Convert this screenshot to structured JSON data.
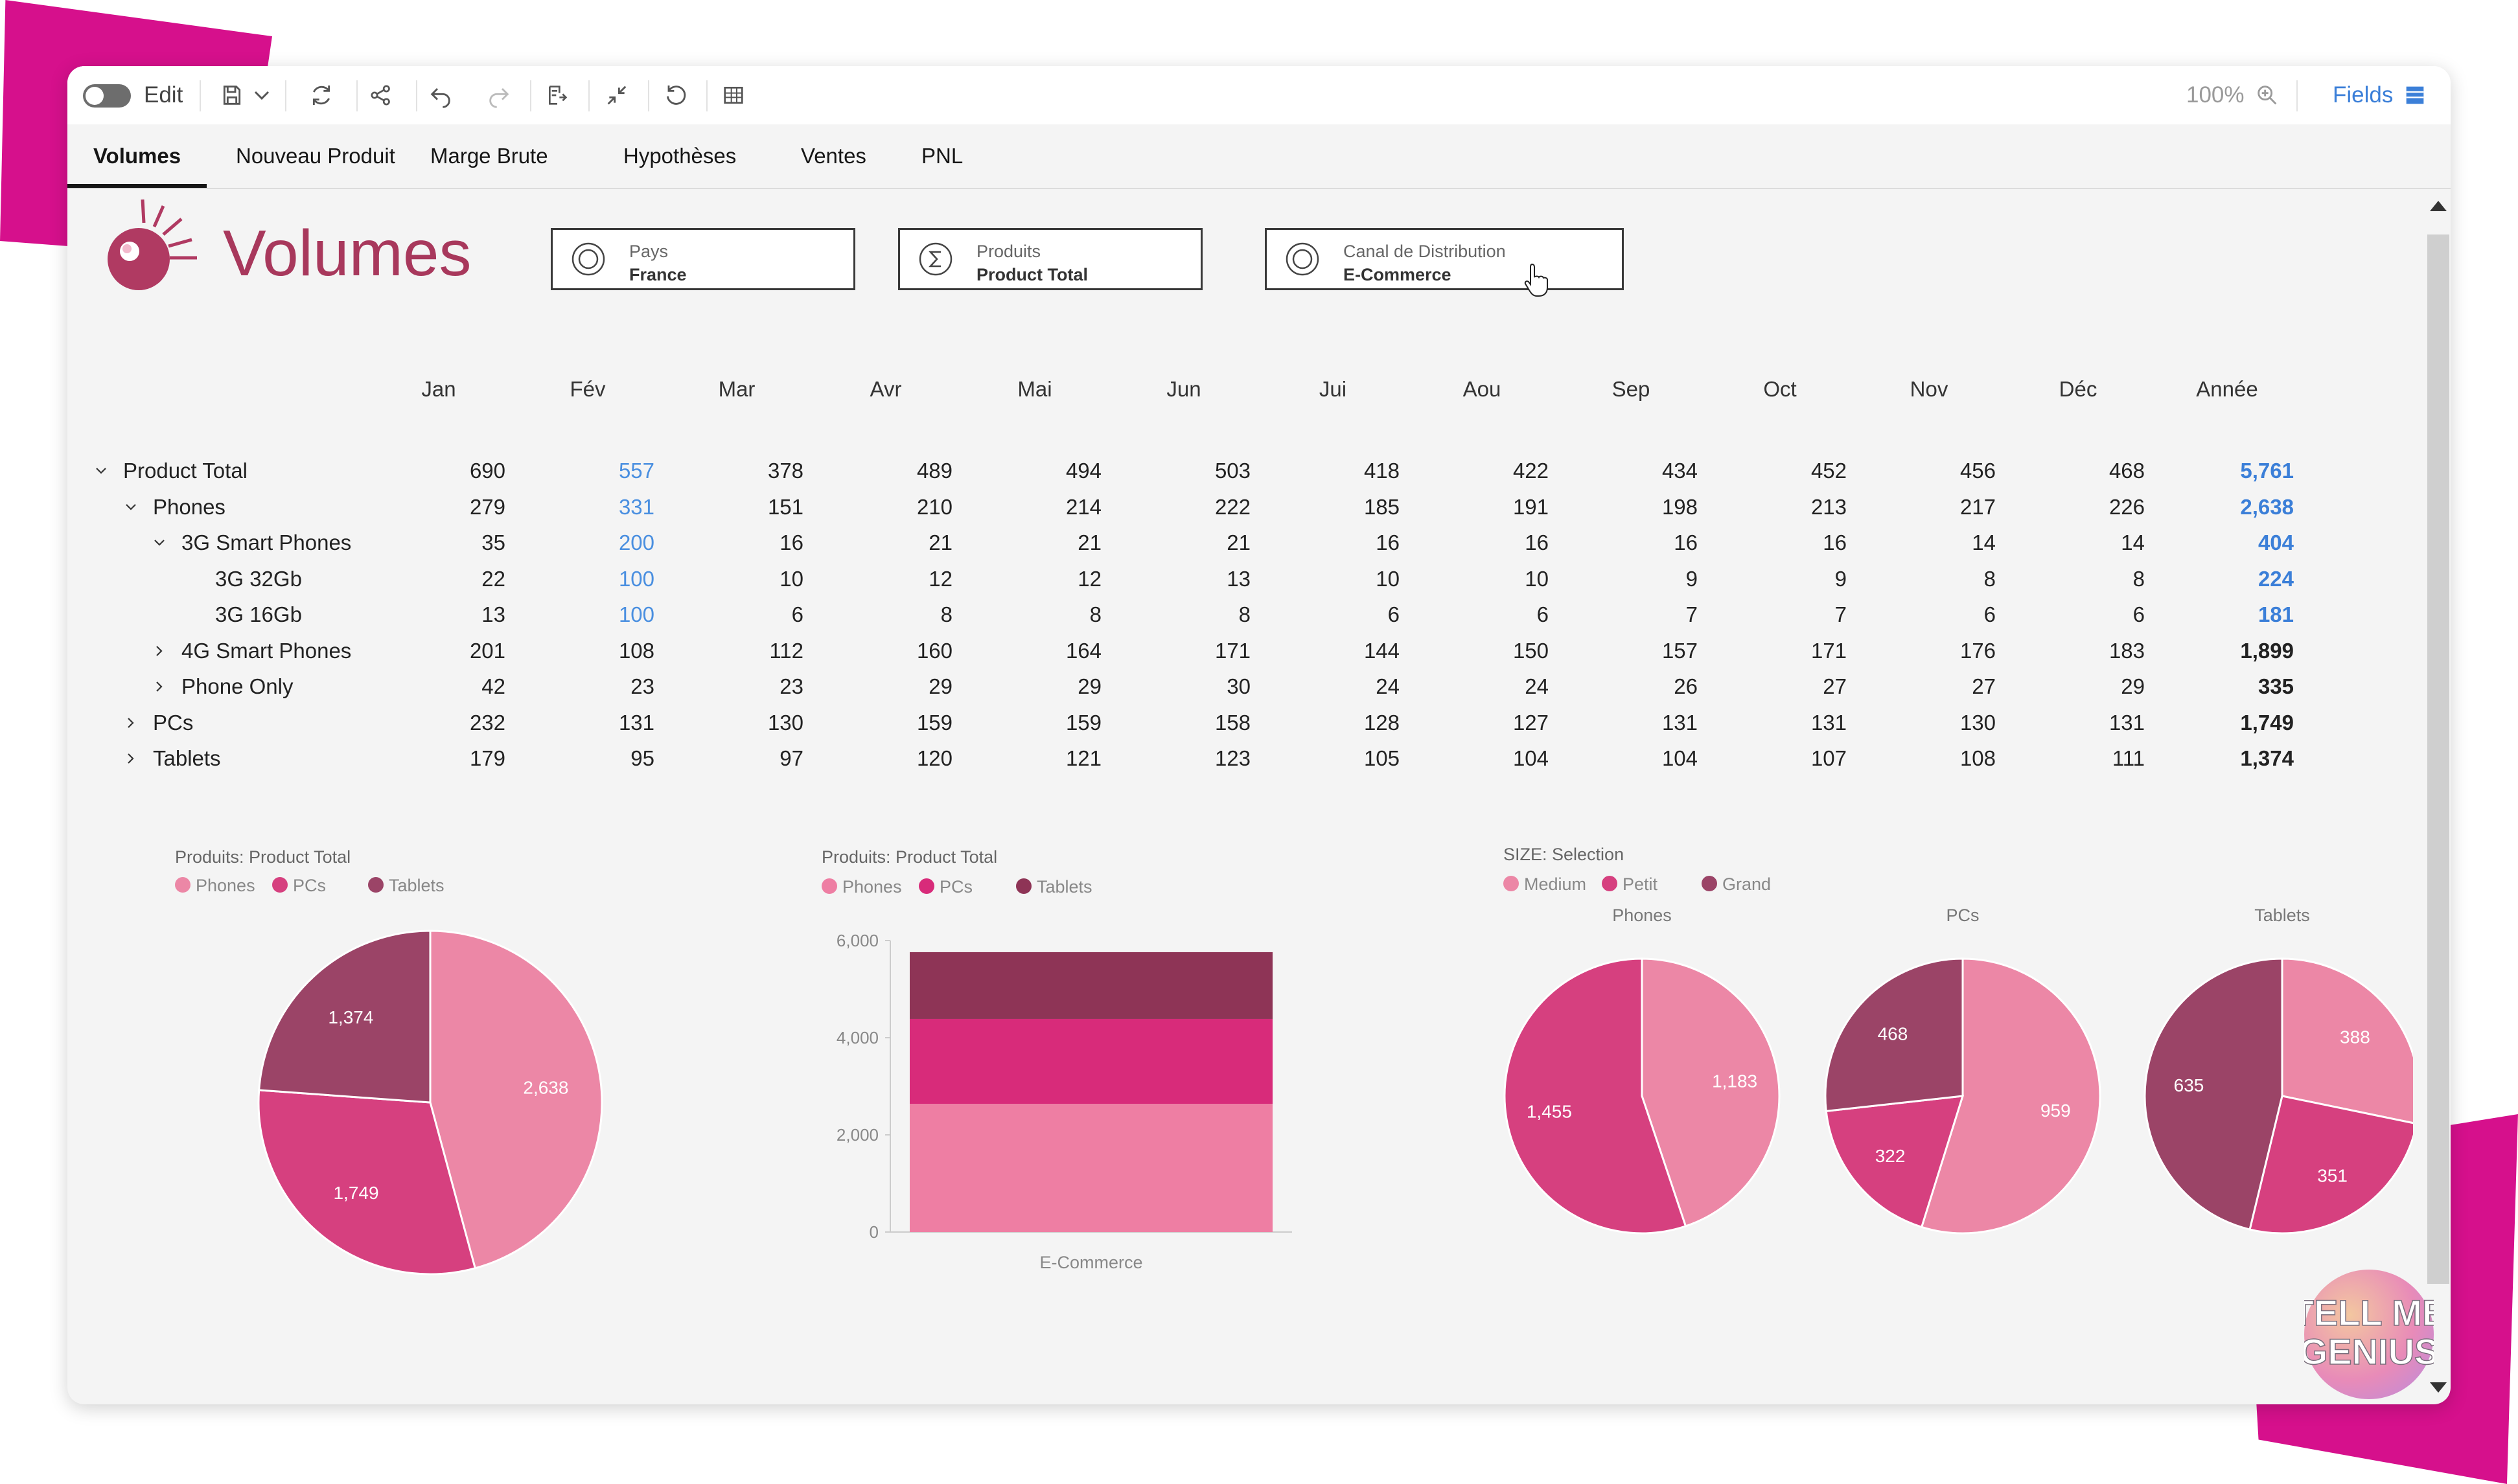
{
  "toolbar": {
    "edit_label": "Edit",
    "zoom": "100%",
    "fields_label": "Fields"
  },
  "tabs": [
    {
      "label": "Volumes"
    },
    {
      "label": "Nouveau Produit"
    },
    {
      "label": "Marge Brute"
    },
    {
      "label": "Hypothèses"
    },
    {
      "label": "Ventes"
    },
    {
      "label": "PNL"
    }
  ],
  "page": {
    "title": "Volumes"
  },
  "filters": [
    {
      "label": "Pays",
      "value": "France",
      "icon": "circle-icon"
    },
    {
      "label": "Produits",
      "value": "Product Total",
      "icon": "sigma-icon"
    },
    {
      "label": "Canal de Distribution",
      "value": "E-Commerce",
      "icon": "circle-icon"
    }
  ],
  "table": {
    "columns": [
      "Jan",
      "Fév",
      "Mar",
      "Avr",
      "Mai",
      "Jun",
      "Jui",
      "Aou",
      "Sep",
      "Oct",
      "Nov",
      "Déc",
      "Année"
    ],
    "rows": [
      {
        "label": "Product Total",
        "values": [
          "690",
          "557",
          "378",
          "489",
          "494",
          "503",
          "418",
          "422",
          "434",
          "452",
          "456",
          "468",
          "5,761"
        ]
      },
      {
        "label": "Phones",
        "values": [
          "279",
          "331",
          "151",
          "210",
          "214",
          "222",
          "185",
          "191",
          "198",
          "213",
          "217",
          "226",
          "2,638"
        ]
      },
      {
        "label": "3G Smart Phones",
        "values": [
          "35",
          "200",
          "16",
          "21",
          "21",
          "21",
          "16",
          "16",
          "16",
          "16",
          "14",
          "14",
          "404"
        ]
      },
      {
        "label": "3G 32Gb",
        "values": [
          "22",
          "100",
          "10",
          "12",
          "12",
          "13",
          "10",
          "10",
          "9",
          "9",
          "8",
          "8",
          "224"
        ]
      },
      {
        "label": "3G 16Gb",
        "values": [
          "13",
          "100",
          "6",
          "8",
          "8",
          "8",
          "6",
          "6",
          "7",
          "7",
          "6",
          "6",
          "181"
        ]
      },
      {
        "label": "4G Smart Phones",
        "values": [
          "201",
          "108",
          "112",
          "160",
          "164",
          "171",
          "144",
          "150",
          "157",
          "171",
          "176",
          "183",
          "1,899"
        ]
      },
      {
        "label": "Phone Only",
        "values": [
          "42",
          "23",
          "23",
          "29",
          "29",
          "30",
          "24",
          "24",
          "26",
          "27",
          "27",
          "29",
          "335"
        ]
      },
      {
        "label": "PCs",
        "values": [
          "232",
          "131",
          "130",
          "159",
          "159",
          "158",
          "128",
          "127",
          "131",
          "131",
          "130",
          "131",
          "1,749"
        ]
      },
      {
        "label": "Tablets",
        "values": [
          "179",
          "95",
          "97",
          "120",
          "121",
          "123",
          "105",
          "104",
          "104",
          "107",
          "108",
          "111",
          "1,374"
        ]
      }
    ]
  },
  "colors": {
    "light_pink": "#ec87a6",
    "magenta": "#d6407f",
    "plum": "#9b4467",
    "bar_light": "#ee7ea3",
    "bar_mid": "#d82b7a",
    "bar_dark": "#8e3456",
    "title": "#a8385c",
    "link_blue": "#4a8fe0"
  },
  "chart_data": [
    {
      "type": "pie",
      "subtitle": "Produits: Product Total",
      "legend": [
        "Phones",
        "PCs",
        "Tablets"
      ],
      "values": [
        2638,
        1749,
        1374
      ],
      "labels": [
        "2,638",
        "1,749",
        "1,374"
      ],
      "colors": [
        "#ec87a6",
        "#d6407f",
        "#9b4467"
      ]
    },
    {
      "type": "bar",
      "stacked": true,
      "subtitle": "Produits: Product Total",
      "legend": [
        "Phones",
        "PCs",
        "Tablets"
      ],
      "categories": [
        "E-Commerce"
      ],
      "series": [
        {
          "name": "Phones",
          "values": [
            2638
          ],
          "color": "#ee7ea3"
        },
        {
          "name": "PCs",
          "values": [
            1749
          ],
          "color": "#d82b7a"
        },
        {
          "name": "Tablets",
          "values": [
            1374
          ],
          "color": "#8e3456"
        }
      ],
      "ylim": [
        0,
        6000
      ],
      "yticks": [
        "0",
        "2,000",
        "4,000",
        "6,000"
      ]
    },
    {
      "type": "pie",
      "subtitle": "SIZE: Selection",
      "legend": [
        "Medium",
        "Petit",
        "Grand"
      ],
      "legend_colors": [
        "#ec87a6",
        "#d6407f",
        "#9b4467"
      ],
      "pies": [
        {
          "title": "Phones",
          "values": [
            1183,
            1455
          ],
          "labels": [
            "1,183",
            "1,455"
          ],
          "colors": [
            "#ec87a6",
            "#d6407f"
          ]
        },
        {
          "title": "PCs",
          "values": [
            959,
            322,
            468
          ],
          "labels": [
            "959",
            "322",
            "468"
          ],
          "colors": [
            "#ec87a6",
            "#d6407f",
            "#9b4467"
          ]
        },
        {
          "title": "Tablets",
          "values": [
            388,
            351,
            635
          ],
          "labels": [
            "388",
            "351",
            "635"
          ],
          "colors": [
            "#ec87a6",
            "#d6407f",
            "#9b4467"
          ]
        }
      ]
    }
  ]
}
